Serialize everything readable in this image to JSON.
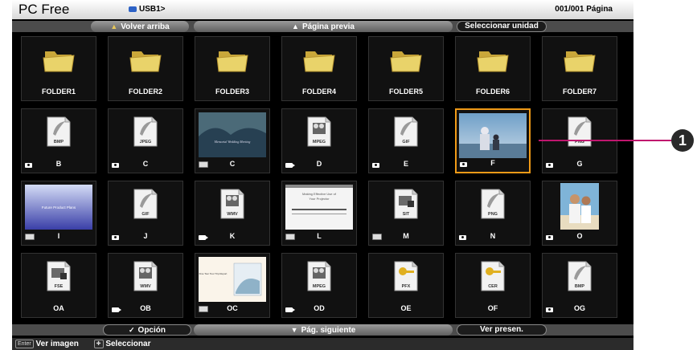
{
  "header": {
    "app_title": "PC Free",
    "path": "USB1>",
    "page_indicator": "001/001 Página"
  },
  "nav": {
    "back_up_label": "Volver arriba",
    "prev_page_label": "Página previa",
    "select_drive_label": "Seleccionar unidad"
  },
  "items": [
    {
      "name": "FOLDER1",
      "kind": "folder"
    },
    {
      "name": "FOLDER2",
      "kind": "folder"
    },
    {
      "name": "FOLDER3",
      "kind": "folder"
    },
    {
      "name": "FOLDER4",
      "kind": "folder"
    },
    {
      "name": "FOLDER5",
      "kind": "folder"
    },
    {
      "name": "FOLDER6",
      "kind": "folder"
    },
    {
      "name": "FOLDER7",
      "kind": "folder"
    },
    {
      "name": "B",
      "kind": "file",
      "ext": "BMP",
      "type": "image"
    },
    {
      "name": "C",
      "kind": "file",
      "ext": "JPEG",
      "type": "image"
    },
    {
      "name": "C",
      "kind": "preview",
      "type": "presentation",
      "preview_title": "Memorial Wedding Meeting"
    },
    {
      "name": "D",
      "kind": "file",
      "ext": "MPEG",
      "type": "movie"
    },
    {
      "name": "E",
      "kind": "file",
      "ext": "GIF",
      "type": "image"
    },
    {
      "name": "F",
      "kind": "photo",
      "type": "image",
      "selected": true
    },
    {
      "name": "G",
      "kind": "file",
      "ext": "PNG",
      "type": "image"
    },
    {
      "name": "I",
      "kind": "preview",
      "type": "presentation",
      "preview_title": "Future Product Plans"
    },
    {
      "name": "J",
      "kind": "file",
      "ext": "GIF",
      "type": "image"
    },
    {
      "name": "K",
      "kind": "file",
      "ext": "WMV",
      "type": "movie"
    },
    {
      "name": "L",
      "kind": "preview",
      "type": "presentation",
      "preview_title": "Making Effective Use of Your Projector"
    },
    {
      "name": "M",
      "kind": "file",
      "ext": "SIT",
      "type": "presentation"
    },
    {
      "name": "N",
      "kind": "file",
      "ext": "PNG",
      "type": "image"
    },
    {
      "name": "O",
      "kind": "photo",
      "type": "image"
    },
    {
      "name": "OA",
      "kind": "file",
      "ext": "FSE"
    },
    {
      "name": "OB",
      "kind": "file",
      "ext": "WMV",
      "type": "movie"
    },
    {
      "name": "OC",
      "kind": "preview",
      "type": "presentation",
      "preview_title": "Fine Tour Tour Trip Report"
    },
    {
      "name": "OD",
      "kind": "file",
      "ext": "MPEG",
      "type": "movie"
    },
    {
      "name": "OE",
      "kind": "file",
      "ext": "PFX"
    },
    {
      "name": "OF",
      "kind": "file",
      "ext": "CER"
    },
    {
      "name": "OG",
      "kind": "file",
      "ext": "BMP",
      "type": "image"
    }
  ],
  "bottom": {
    "option_label": "Opción",
    "next_page_label": "Pág. siguiente",
    "slideshow_label": "Ver presen."
  },
  "footer": {
    "enter_key": "Enter",
    "view_image": "Ver imagen",
    "select": "Seleccionar"
  },
  "callout": "1",
  "colors": {
    "selection": "#f09a17",
    "callout_line": "#c0166e",
    "folder": "#e9d36a"
  }
}
